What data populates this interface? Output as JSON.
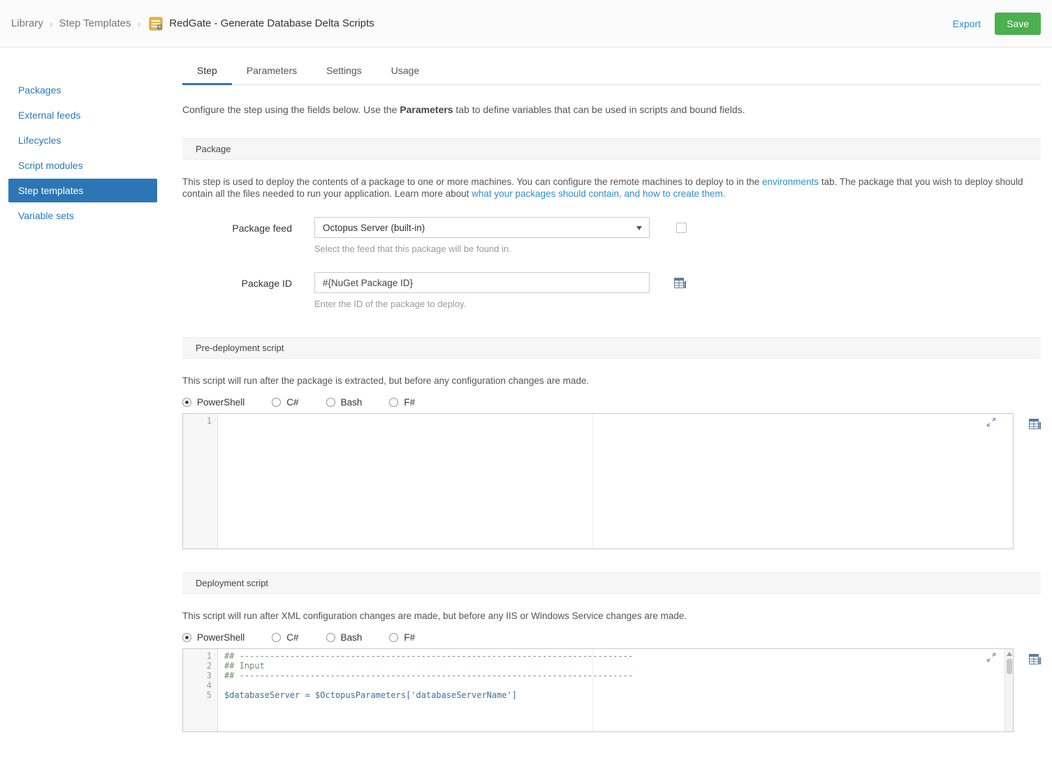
{
  "topbar": {
    "breadcrumb1": "Library",
    "breadcrumb2": "Step Templates",
    "separator": "›",
    "title": "RedGate - Generate Database Delta Scripts",
    "export_label": "Export",
    "save_label": "Save"
  },
  "sidebar": {
    "items": [
      {
        "label": "Packages"
      },
      {
        "label": "External feeds"
      },
      {
        "label": "Lifecycles"
      },
      {
        "label": "Script modules"
      },
      {
        "label": "Step templates"
      },
      {
        "label": "Variable sets"
      }
    ]
  },
  "tabs": [
    {
      "label": "Step"
    },
    {
      "label": "Parameters"
    },
    {
      "label": "Settings"
    },
    {
      "label": "Usage"
    }
  ],
  "intro": {
    "before": "Configure the step using the fields below. Use the ",
    "bold": "Parameters",
    "after": " tab to define variables that can be used in scripts and bound fields."
  },
  "package_section": {
    "header": "Package",
    "desc_part1": "This step is used to deploy the contents of a package to one or more machines. You can configure the remote machines to deploy to in the ",
    "desc_link1": "environments",
    "desc_part2": " tab. The package that you wish to deploy should contain all the files needed to run your application. Learn more about ",
    "desc_link2": "what your packages should contain, and how to create them.",
    "package_feed": {
      "label": "Package feed",
      "value": "Octopus Server (built-in)",
      "help": "Select the feed that this package will be found in."
    },
    "package_id": {
      "label": "Package ID",
      "value": "#{NuGet Package ID}",
      "help": "Enter the ID of the package to deploy."
    }
  },
  "pre_script_section": {
    "header": "Pre-deployment script",
    "desc": "This script will run after the package is extracted, but before any configuration changes are made.",
    "languages": [
      {
        "label": "PowerShell"
      },
      {
        "label": "C#"
      },
      {
        "label": "Bash"
      },
      {
        "label": "F#"
      }
    ],
    "selected_language": "PowerShell",
    "lines": [
      {
        "num": "1",
        "text": ""
      }
    ]
  },
  "deploy_script_section": {
    "header": "Deployment script",
    "desc": "This script will run after XML configuration changes are made, but before any IIS or Windows Service changes are made.",
    "languages": [
      {
        "label": "PowerShell"
      },
      {
        "label": "C#"
      },
      {
        "label": "Bash"
      },
      {
        "label": "F#"
      }
    ],
    "selected_language": "PowerShell",
    "lines": [
      {
        "num": "1",
        "text": "## ------------------------------------------------------------------------------"
      },
      {
        "num": "2",
        "text": "## Input"
      },
      {
        "num": "3",
        "text": "## ------------------------------------------------------------------------------"
      },
      {
        "num": "4",
        "text": ""
      },
      {
        "num": "5",
        "text": "$databaseServer = $OctopusParameters['databaseServerName']"
      }
    ]
  },
  "colors": {
    "accent_blue": "#2d76b5",
    "save_green": "#4caf50",
    "link_blue": "#2e8fd0",
    "comment_green": "#6f8f6f"
  }
}
